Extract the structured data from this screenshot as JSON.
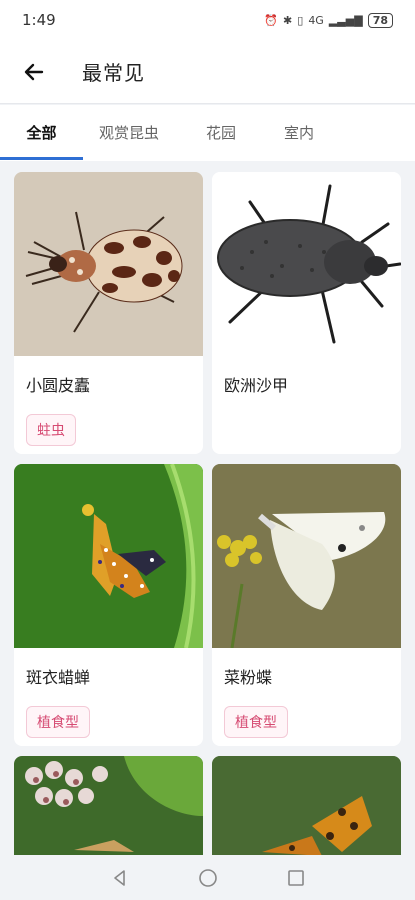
{
  "status": {
    "time": "1:49",
    "network": "4G",
    "battery": "78"
  },
  "header": {
    "title": "最常见"
  },
  "tabs": [
    {
      "label": "全部",
      "active": true
    },
    {
      "label": "观赏昆虫",
      "active": false
    },
    {
      "label": "花园",
      "active": false
    },
    {
      "label": "室内",
      "active": false
    }
  ],
  "cards": [
    {
      "name": "小圆皮蠹",
      "tag": "蛀虫"
    },
    {
      "name": "欧洲沙甲",
      "tag": ""
    },
    {
      "name": "斑衣蜡蝉",
      "tag": "植食型"
    },
    {
      "name": "菜粉蝶",
      "tag": "植食型"
    }
  ],
  "colors": {
    "accent": "#2f6fd4",
    "tag_text": "#d64a72",
    "tag_border": "#f3c9d6"
  }
}
